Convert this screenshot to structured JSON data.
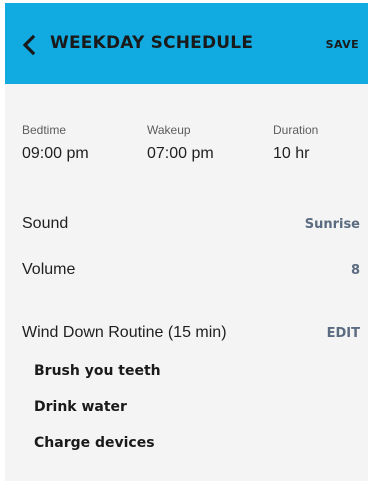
{
  "header": {
    "title": "WEEKDAY SCHEDULE",
    "save_label": "SAVE",
    "back_icon": "chevron-left-icon",
    "background_color": "#11abe1"
  },
  "times": [
    {
      "label": "Bedtime",
      "value": "09:00 pm"
    },
    {
      "label": "Wakeup",
      "value": "07:00 pm"
    },
    {
      "label": "Duration",
      "value": "10 hr"
    }
  ],
  "sound": {
    "label": "Sound",
    "value": "Sunrise"
  },
  "volume": {
    "label": "Volume",
    "value": "8"
  },
  "wind_down": {
    "label": "Wind Down Routine (15 min)",
    "edit_label": "EDIT",
    "items": [
      "Brush you teeth",
      "Drink water",
      "Charge devices"
    ]
  },
  "colors": {
    "accent": "#11abe1",
    "value_text": "#5b6b80",
    "panel_background": "#f4f4f4"
  }
}
